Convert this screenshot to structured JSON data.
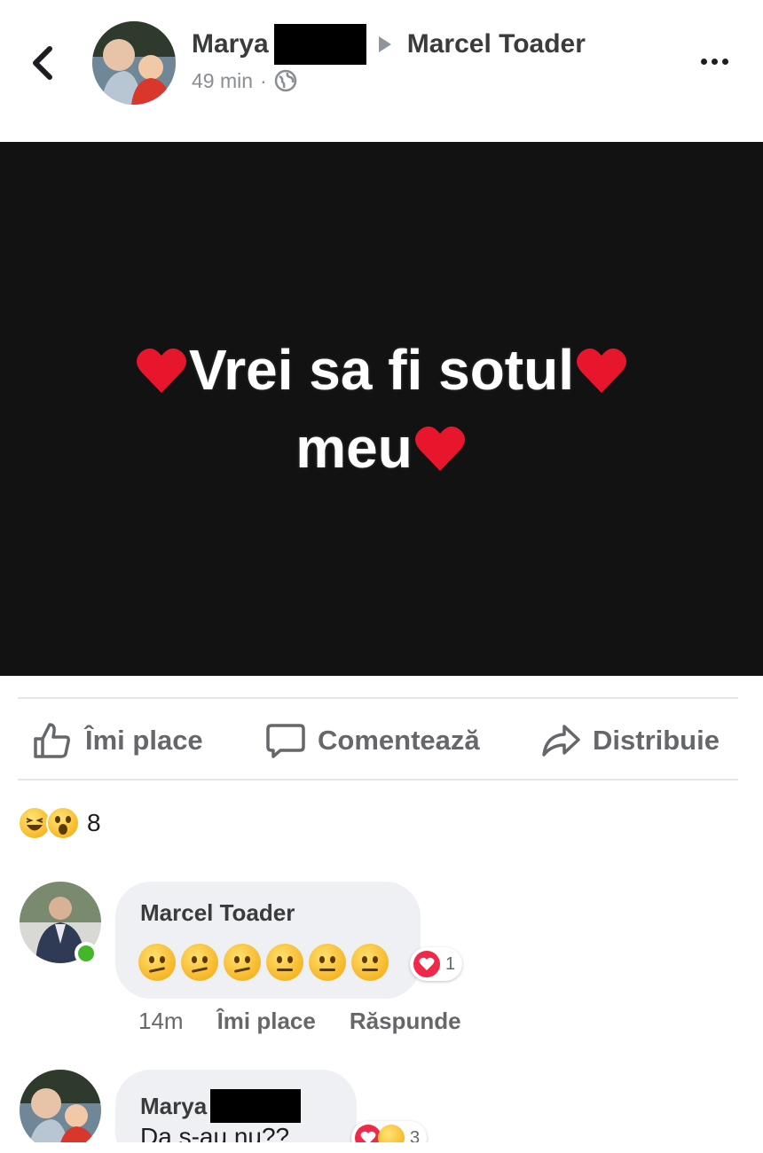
{
  "post": {
    "author_name": "Marya",
    "target_name": "Marcel Toader",
    "time": "49 min",
    "audience_icon": "globe-icon",
    "text_line1": "Vrei sa fi sotul",
    "text_line2": "meu",
    "background_color": "#121212"
  },
  "actions": {
    "like": "Îmi place",
    "comment": "Comentează",
    "share": "Distribuie"
  },
  "reactions": {
    "types": [
      "haha",
      "wow"
    ],
    "count": "8"
  },
  "comments": [
    {
      "author": "Marcel Toader",
      "online": true,
      "content_emojis": [
        "thinking-face",
        "thinking-face",
        "thinking-face",
        "face-with-raised-eyebrow",
        "face-with-raised-eyebrow",
        "face-with-raised-eyebrow"
      ],
      "reaction_icon": "love",
      "reaction_count": "1",
      "time": "14m",
      "like_label": "Îmi place",
      "reply_label": "Răspunde"
    },
    {
      "author": "Marya",
      "text": "Da s-au nu??",
      "reaction_icons": [
        "love",
        "wow"
      ],
      "reaction_count": "3"
    }
  ],
  "colors": {
    "accent_heart": "#f0284a",
    "online": "#42b72a",
    "muted_text": "#65676b"
  }
}
